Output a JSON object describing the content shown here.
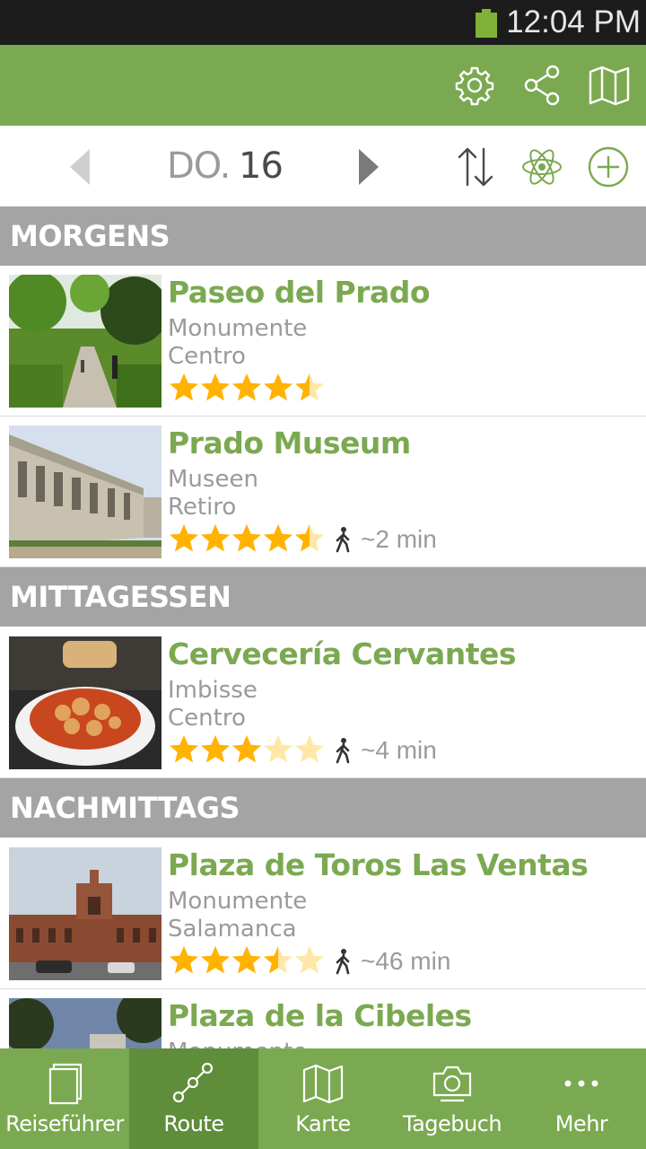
{
  "status_bar": {
    "time": "12:04 PM",
    "battery_color": "#7fb236"
  },
  "action_bar": {
    "background": "#7ba951",
    "icons": [
      "gear-icon",
      "share-icon",
      "map-icon"
    ]
  },
  "day_nav": {
    "day_label": "DO.",
    "day_number": "16",
    "icons": [
      "prev-day-icon",
      "next-day-icon",
      "sort-icon",
      "atom-icon",
      "add-icon"
    ]
  },
  "sections": [
    {
      "header": "MORGENS",
      "items": [
        {
          "title": "Paseo del Prado",
          "category": "Monumente",
          "district": "Centro",
          "rating": 4.5,
          "walk_time": ""
        }
      ]
    },
    {
      "header": "",
      "items": [
        {
          "title": "Prado Museum",
          "category": "Museen",
          "district": "Retiro",
          "rating": 4.5,
          "walk_time": "~2 min"
        }
      ]
    },
    {
      "header": "MITTAGESSEN",
      "items": [
        {
          "title": "Cervecería Cervantes",
          "category": "Imbisse",
          "district": "Centro",
          "rating": 3,
          "walk_time": "~4 min"
        }
      ]
    },
    {
      "header": "NACHMITTAGS",
      "items": [
        {
          "title": "Plaza de Toros Las Ventas",
          "category": "Monumente",
          "district": "Salamanca",
          "rating": 3.5,
          "walk_time": "~46 min"
        },
        {
          "title": "Plaza de la Cibeles",
          "category": "Monumente",
          "district": "",
          "rating": 0,
          "walk_time": ""
        }
      ]
    }
  ],
  "bottom_nav": {
    "tabs": [
      {
        "label": "Reiseführer",
        "icon": "guidebook-icon",
        "active": false
      },
      {
        "label": "Route",
        "icon": "route-icon",
        "active": true
      },
      {
        "label": "Karte",
        "icon": "map-icon",
        "active": false
      },
      {
        "label": "Tagebuch",
        "icon": "camera-icon",
        "active": false
      },
      {
        "label": "Mehr",
        "icon": "more-icon",
        "active": false
      }
    ]
  },
  "colors": {
    "accent": "#7ba951",
    "accent_dark": "#5f8d3a",
    "section_header": "#a4a4a4",
    "star": "#ffb300",
    "star_empty": "#ffe7a8"
  }
}
